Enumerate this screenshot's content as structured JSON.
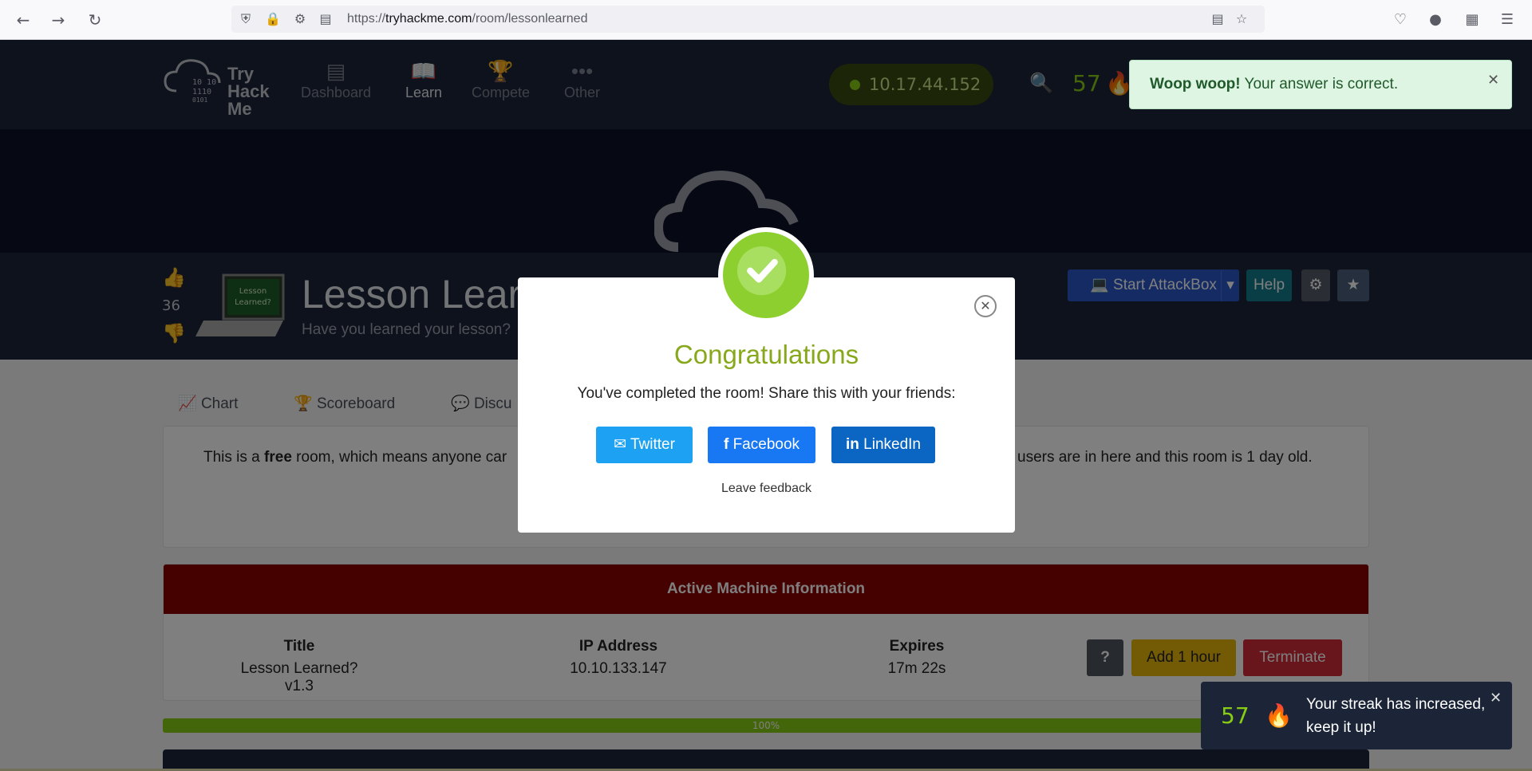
{
  "browser": {
    "url_prefix": "https://",
    "url_domain": "tryhackme.com",
    "url_path": "/room/lessonlearned"
  },
  "header": {
    "logo_line1": "Try",
    "logo_line2": "Hack",
    "logo_line3": "Me",
    "nav": [
      {
        "label": "Dashboard"
      },
      {
        "label": "Learn"
      },
      {
        "label": "Compete"
      },
      {
        "label": "Other"
      }
    ],
    "ip": "10.17.44.152",
    "streak": "57"
  },
  "room": {
    "votes": "36",
    "title": "Lesson Lear",
    "subtitle": "Have you learned your lesson?",
    "thumb_text1": "Lesson",
    "thumb_text2": "Learned?",
    "buttons": {
      "attackbox": "Start AttackBox",
      "help": "Help"
    }
  },
  "tabs": [
    {
      "label": "Chart"
    },
    {
      "label": "Scoreboard"
    },
    {
      "label": "Discu"
    }
  ],
  "info": {
    "text_pre": "This is a ",
    "text_bold": "free",
    "text_post": " room, which means anyone car",
    "text_right": "users are in here and this room is 1 day old."
  },
  "machine": {
    "heading": "Active Machine Information",
    "title_label": "Title",
    "title_value": "Lesson Learned? v1.3",
    "ip_label": "IP Address",
    "ip_value": "10.10.133.147",
    "expires_label": "Expires",
    "expires_value": "17m 22s",
    "help_label": "?",
    "add_label": "Add 1 hour",
    "terminate_label": "Terminate"
  },
  "progress": {
    "label": "100%",
    "value": 100
  },
  "modal": {
    "title": "Congratulations",
    "body": "You've completed the room! Share this with your friends:",
    "twitter": "Twitter",
    "facebook": "Facebook",
    "linkedin": "LinkedIn",
    "feedback": "Leave feedback"
  },
  "toast_success": {
    "bold": "Woop woop!",
    "text": " Your answer is correct."
  },
  "toast_streak": {
    "count": "57",
    "message": "Your streak has increased, keep it up!"
  },
  "colors": {
    "accent": "#88cc14",
    "header_bg": "#1c2538",
    "machine_head": "#8b0000"
  }
}
